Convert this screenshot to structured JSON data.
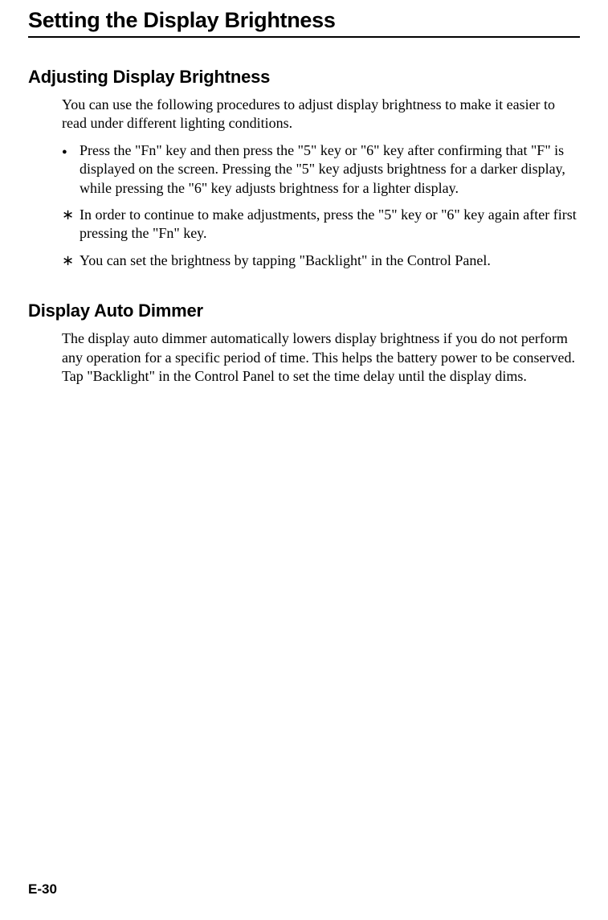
{
  "page_title": "Setting the Display Brightness",
  "section1": {
    "heading": "Adjusting Display Brightness",
    "intro": "You can use the following procedures to adjust display brightness to make it easier to read under different lighting conditions.",
    "items": [
      {
        "mark": "●",
        "text": "Press the \"Fn\" key and then press the \"5\" key or \"6\" key after confirming that \"F\" is displayed on the screen. Pressing the \"5\" key adjusts brightness for a darker display, while pressing the \"6\" key adjusts brightness for a lighter display."
      },
      {
        "mark": "∗",
        "text": "In order to continue to make adjustments, press the \"5\" key or \"6\" key again after first pressing the \"Fn\" key."
      },
      {
        "mark": "∗",
        "text": "You can set the brightness by tapping \"Backlight\" in the Control Panel."
      }
    ]
  },
  "section2": {
    "heading": "Display Auto Dimmer",
    "para1": "The display auto dimmer automatically lowers display brightness if you do not perform any operation for a specific period of time. This helps the battery power to be conserved.",
    "para2": "Tap \"Backlight\" in the Control Panel to set the time delay until the display dims."
  },
  "page_number": "E-30"
}
